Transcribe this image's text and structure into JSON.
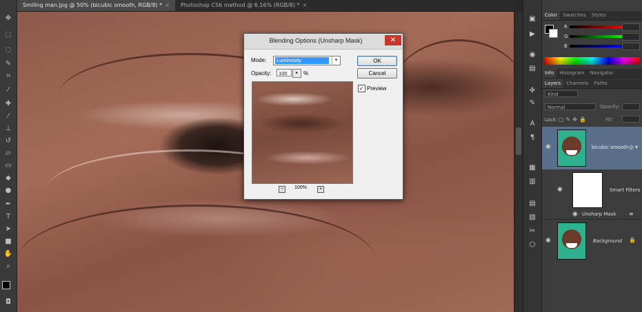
{
  "document_tabs": [
    {
      "label": "Smiling man.jpg @ 50% (bicubic smooth, RGB/8) *",
      "active": true
    },
    {
      "label": "Photoshop CS6 method @ 6.16% (RGB/8) *",
      "active": false
    }
  ],
  "tab_close_glyph": "×",
  "color_panel": {
    "tabs": [
      "Color",
      "Swatches",
      "Styles"
    ],
    "channels": [
      "R",
      "G",
      "B"
    ]
  },
  "info_panel": {
    "tabs": [
      "Info",
      "Histogram",
      "Navigator"
    ]
  },
  "layers_panel": {
    "tabs": [
      "Layers",
      "Channels",
      "Paths"
    ],
    "filter_kind": "Kind",
    "blend_mode": "Normal",
    "opacity_label": "Opacity:",
    "lock_label": "Lock:",
    "fill_label": "Fill:",
    "layers": [
      {
        "name": "bicubic smooth",
        "type": "smart-object"
      },
      {
        "name": "Smart Filters",
        "type": "filter-mask"
      },
      {
        "name": "Unsharp Mask",
        "type": "filter"
      },
      {
        "name": "Background",
        "type": "background"
      }
    ]
  },
  "dialog": {
    "title": "Blending Options (Unsharp Mask)",
    "close_glyph": "✕",
    "mode_label": "Mode:",
    "mode_value": "Luminosity",
    "opacity_label": "Opacity:",
    "opacity_value": "100",
    "opacity_unit": "%",
    "ok_label": "OK",
    "cancel_label": "Cancel",
    "preview_label": "Preview",
    "preview_checked": true,
    "zoom_value": "100%",
    "zoom_out_glyph": "−",
    "zoom_in_glyph": "+"
  },
  "icons": {
    "toolbar": [
      "move-icon",
      "marquee-icon",
      "lasso-icon",
      "quick-select-icon",
      "crop-icon",
      "eyedropper-icon",
      "healing-icon",
      "brush-icon",
      "clone-stamp-icon",
      "history-brush-icon",
      "eraser-icon",
      "gradient-icon",
      "blur-icon",
      "dodge-icon",
      "pen-icon",
      "type-icon",
      "path-select-icon",
      "shape-icon",
      "hand-icon",
      "zoom-icon"
    ],
    "dock": [
      "history-icon",
      "actions-icon",
      "properties-icon",
      "adjustments-icon",
      "paragraph-icon",
      "character-icon",
      "brush-presets-icon",
      "clone-source-icon",
      "tool-presets-icon",
      "notes-icon"
    ]
  },
  "colors": {
    "accent": "#3399ff",
    "dialog_close": "#c9372c",
    "selected_layer": "#5a6f8a"
  }
}
